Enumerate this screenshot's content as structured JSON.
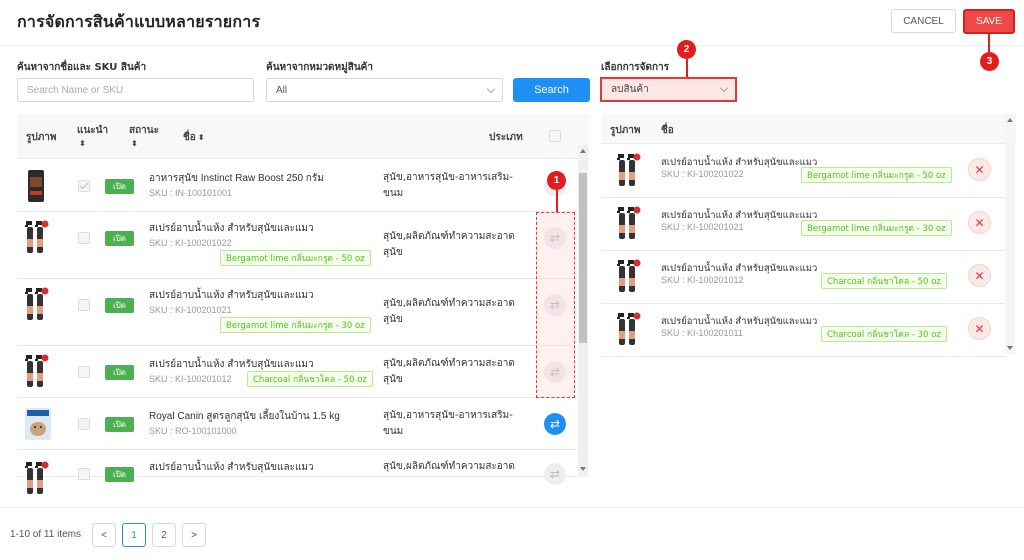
{
  "header": {
    "title": "การจัดการสินค้าแบบหลายรายการ",
    "cancel_label": "CANCEL",
    "save_label": "SAVE"
  },
  "filters": {
    "name_label": "ค้นหาจากชื่อและ SKU สินค้า",
    "name_placeholder": "Search Name or SKU",
    "category_label": "ค้นหาจากหมวดหมู่สินค้า",
    "category_value": "All",
    "search_label": "Search",
    "action_label": "เลือกการจัดการ",
    "action_value": "ลบสินค้า"
  },
  "badges": [
    "1",
    "2",
    "3"
  ],
  "left_table": {
    "headers": {
      "image": "รูปภาพ",
      "recommend": "แนะนำ",
      "status": "สถานะ",
      "name": "ชื่อ",
      "type": "ประเภท"
    },
    "rows": [
      {
        "name": "อาหารสุนัข Instinct Raw Boost 250 กรัม",
        "sku": "SKU : IN-100101001",
        "tag": "",
        "status": "เปิด",
        "category": "สุนัข,อาหารสุนัข-อาหารเสริม-ขนม",
        "checked": true,
        "swap_active": false,
        "image_icon": "dog-food-bag-icon"
      },
      {
        "name": "สเปรย์อาบน้ำแห้ง สำหรับสุนัขและแมว",
        "sku": "SKU : KI-100201022",
        "tag": "Bergamot lime กลิ่นมะกรูด - 50 oz",
        "status": "เปิด",
        "category": "สุนัข,ผลิตภัณฑ์ทำความสะอาดสุนัข",
        "checked": false,
        "swap_active": false,
        "image_icon": "spray-bottles-icon"
      },
      {
        "name": "สเปรย์อาบน้ำแห้ง สำหรับสุนัขและแมว",
        "sku": "SKU : KI-100201021",
        "tag": "Bergamot lime กลิ่นมะกรูด - 30 oz",
        "status": "เปิด",
        "category": "สุนัข,ผลิตภัณฑ์ทำความสะอาดสุนัข",
        "checked": false,
        "swap_active": false,
        "image_icon": "spray-bottles-icon"
      },
      {
        "name": "สเปรย์อาบน้ำแห้ง สำหรับสุนัขและแมว",
        "sku": "SKU : KI-100201012",
        "tag": "Charcoal กลิ่นชาโคล - 50 oz",
        "status": "เปิด",
        "category": "สุนัข,ผลิตภัณฑ์ทำความสะอาดสุนัข",
        "checked": false,
        "swap_active": false,
        "image_icon": "spray-bottles-icon"
      },
      {
        "name": "Royal Canin สูตรลูกสุนัข เลี้ยงในบ้าน 1.5 kg",
        "sku": "SKU : RO-100101000",
        "tag": "",
        "status": "เปิด",
        "category": "สุนัข,อาหารสุนัข-อาหารเสริม-ขนม",
        "checked": false,
        "swap_active": true,
        "image_icon": "royal-canin-bag-icon"
      },
      {
        "name": "สเปรย์อาบน้ำแห้ง สำหรับสุนัขและแมว",
        "sku": "",
        "tag": "",
        "status": "เปิด",
        "category": "สุนัข,ผลิตภัณฑ์ทำความสะอาด",
        "checked": false,
        "swap_active": false,
        "image_icon": "spray-bottles-icon"
      }
    ]
  },
  "right_table": {
    "headers": {
      "image": "รูปภาพ",
      "name": "ชื่อ"
    },
    "rows": [
      {
        "name": "สเปรย์อาบน้ำแห้ง สำหรับสุนัขและแมว",
        "sku": "SKU : KI-100201022",
        "tag": "Bergamot lime กลิ่นมะกรูด - 50 oz"
      },
      {
        "name": "สเปรย์อาบน้ำแห้ง สำหรับสุนัขและแมว",
        "sku": "SKU : KI-100201021",
        "tag": "Bergamot lime กลิ่นมะกรูด - 30 oz"
      },
      {
        "name": "สเปรย์อาบน้ำแห้ง สำหรับสุนัขและแมว",
        "sku": "SKU : KI-100201012",
        "tag": "Charcoal กลิ่นชาโคล - 50 oz"
      },
      {
        "name": "สเปรย์อาบน้ำแห้ง สำหรับสุนัขและแมว",
        "sku": "SKU : KI-100201011",
        "tag": "Charcoal กลิ่นชาโคล - 30 oz"
      }
    ]
  },
  "pagination": {
    "summary": "1-10 of 11 items",
    "prev": "<",
    "pages": [
      "1",
      "2"
    ],
    "next": ">",
    "active_page": "1"
  },
  "colors": {
    "primary": "#1e8ff5",
    "danger": "#e53935",
    "status_green": "#4caf50",
    "tag_green": "#52c41a"
  }
}
